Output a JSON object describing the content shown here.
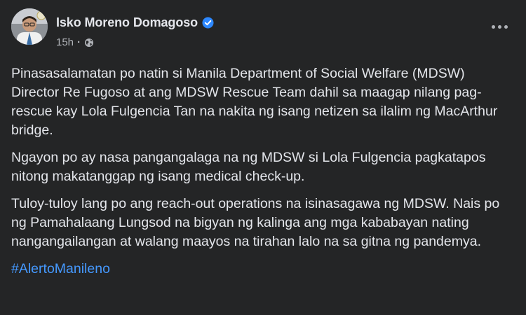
{
  "post": {
    "author": {
      "name": "Isko Moreno Domagoso",
      "verified": true
    },
    "timestamp": "15h",
    "privacy_icon": "globe-icon",
    "more_icon": "more-options-icon",
    "paragraphs": [
      "Pinasasalamatan po natin si Manila Department of Social Welfare (MDSW) Director Re Fugoso at ang MDSW Rescue Team dahil sa maagap nilang pag-rescue kay Lola Fulgencia Tan na nakita ng isang netizen sa ilalim ng MacArthur bridge.",
      "Ngayon po ay nasa pangangalaga na ng MDSW si Lola Fulgencia pagkatapos nitong makatanggap ng isang medical check-up.",
      "Tuloy-tuloy lang po ang reach-out operations na isinasagawa ng MDSW. Nais po ng Pamahalaang Lungsod na bigyan ng kalinga ang mga kababayan nating nangangailangan at walang maayos na tirahan lalo na sa gitna ng pandemya."
    ],
    "hashtag": "#AlertoManileno"
  },
  "colors": {
    "background": "#242526",
    "text_primary": "#e4e6eb",
    "text_secondary": "#b0b3b8",
    "link": "#4599ff",
    "verified_badge": "#2d88ff"
  }
}
